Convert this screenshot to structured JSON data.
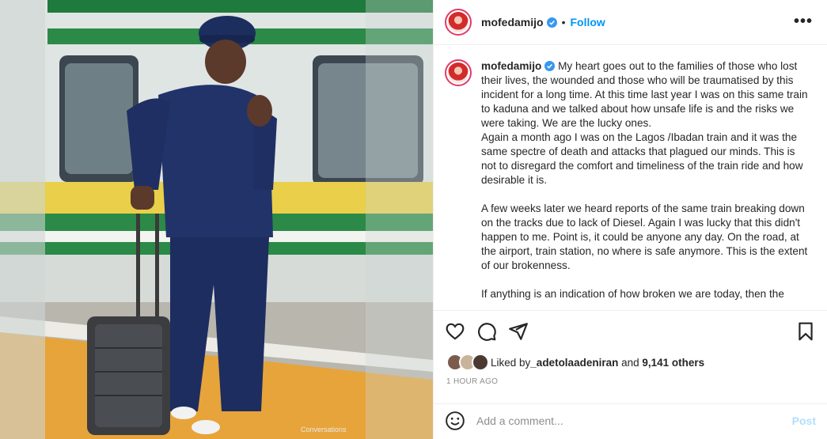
{
  "post": {
    "username": "mofedamijo",
    "separator": "•",
    "follow_label": "Follow",
    "more_label": "•••",
    "caption_username": "mofedamijo",
    "caption_text": " My heart goes out to the families of those who lost their lives, the wounded and those who will be traumatised by this incident for a long time. At this time last year I was on this same train to kaduna and we talked about how unsafe life is and the risks we were taking. We are the lucky ones.\nAgain a month ago I was on the Lagos /Ibadan train and it was the same spectre of death and attacks that plagued our minds. This is not to disregard the comfort and timeliness of the train ride and how desirable it is.\n\nA few weeks later we heard reports of the same train breaking down on the tracks due to lack of Diesel. Again I was lucky that this didn't happen to me. Point is, it could be anyone any day. On the road, at the airport, train station, no where is safe anymore. This is the extent of our brokenness.\n\nIf anything is an indication of how broken we are today, then the",
    "liked_by_prefix": "Liked by ",
    "liked_by_user": "_adetolaadeniran",
    "liked_by_mid": " and ",
    "liked_by_count": "9,141 others",
    "time_ago": "1 HOUR AGO",
    "comment_placeholder": "Add a comment...",
    "post_label": "Post"
  },
  "photo": {
    "watermark": "Conversations"
  },
  "colors": {
    "follow": "#0095f6",
    "post_disabled": "#b2dffc",
    "story_ring": "#e23a6a"
  },
  "icons": [
    "verified-badge-icon",
    "more-options-icon",
    "heart-icon",
    "comment-icon",
    "share-icon",
    "bookmark-icon",
    "emoji-icon"
  ]
}
